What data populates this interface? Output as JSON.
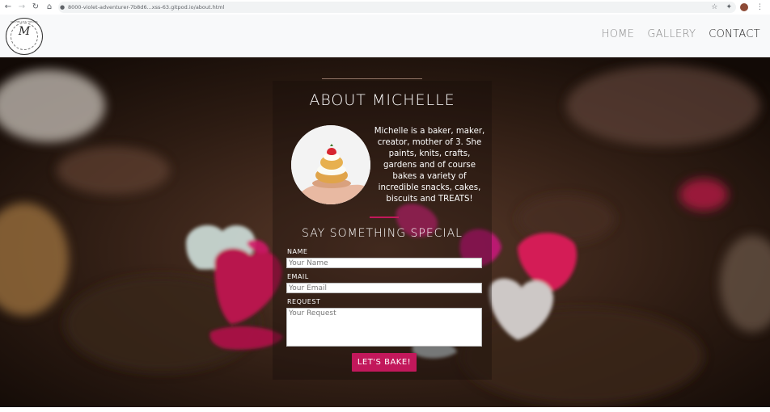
{
  "browser": {
    "url": "8000-violet-adventurer-7b8d6...xss-63.gitpod.io/about.html",
    "back_icon": "arrow-left-icon",
    "forward_icon": "arrow-right-icon",
    "reload_icon": "reload-icon",
    "home_icon": "home-icon"
  },
  "site": {
    "logo_monogram": "M",
    "logo_ring_text": "MICHELLE'S TREATS",
    "nav": [
      {
        "label": "HOME"
      },
      {
        "label": "GALLERY"
      },
      {
        "label": "CONTACT"
      }
    ]
  },
  "about": {
    "title": "ABOUT MICHELLE",
    "bio": "Michelle is a baker, maker, creator, mother of 3. She paints, knits, crafts, gardens and of course bakes a variety of incredible snacks, cakes, biscuits and TREATS!"
  },
  "form": {
    "title": "SAY SOMETHING SPECIAL",
    "name_label": "NAME",
    "name_placeholder": "Your Name",
    "email_label": "EMAIL",
    "email_placeholder": "Your Email",
    "request_label": "REQUEST",
    "request_placeholder": "Your Request",
    "submit_label": "LET'S BAKE!"
  },
  "colors": {
    "accent": "#c2185b",
    "header_bg": "#f8f9fa",
    "nav_active": "#222222",
    "nav_inactive": "#888888"
  }
}
